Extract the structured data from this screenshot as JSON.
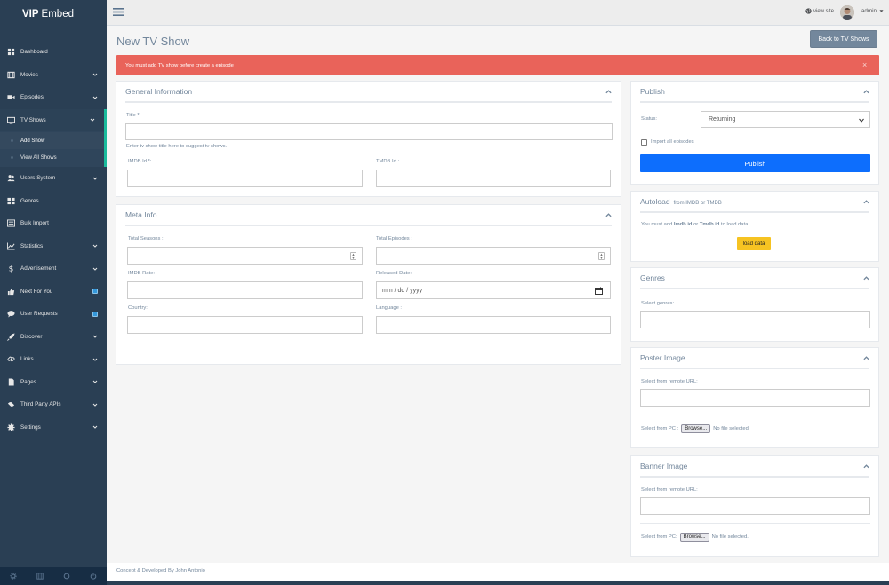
{
  "brand": {
    "name_bold": "VIP",
    "name_rest": "Embed"
  },
  "sidebar": {
    "items": [
      {
        "label": "Dashboard",
        "icon": "dashboard-icon",
        "chevron": false
      },
      {
        "label": "Movies",
        "icon": "film-icon",
        "chevron": true
      },
      {
        "label": "Episodes",
        "icon": "video-camera-icon",
        "chevron": true
      },
      {
        "label": "TV Shows",
        "icon": "tv-icon",
        "chevron": true,
        "active": true
      },
      {
        "label": "Users System",
        "icon": "users-icon",
        "chevron": true
      },
      {
        "label": "Genres",
        "icon": "grid-icon",
        "chevron": false
      },
      {
        "label": "Bulk Import",
        "icon": "list-icon",
        "chevron": false
      },
      {
        "label": "Statistics",
        "icon": "chart-icon",
        "chevron": true
      },
      {
        "label": "Advertisement",
        "icon": "dollar-icon",
        "chevron": true
      },
      {
        "label": "Next For You",
        "icon": "thumbs-up-icon",
        "badge": true
      },
      {
        "label": "User Requests",
        "icon": "comments-icon",
        "badge": true
      },
      {
        "label": "Discover",
        "icon": "rocket-icon",
        "chevron": true
      },
      {
        "label": "Links",
        "icon": "link-icon",
        "chevron": true
      },
      {
        "label": "Pages",
        "icon": "file-icon",
        "chevron": true
      },
      {
        "label": "Third Party APIs",
        "icon": "code-icon",
        "chevron": true
      },
      {
        "label": "Settings",
        "icon": "gear-icon",
        "chevron": true
      }
    ],
    "tv_sub": [
      {
        "label": "Add Show",
        "current": true
      },
      {
        "label": "View All Shows",
        "current": false
      }
    ]
  },
  "topbar": {
    "view_site": "view site",
    "user": "admin"
  },
  "page": {
    "title": "New TV Show",
    "back_button": "Back to TV Shows",
    "alert": "You must add TV show before create a episode"
  },
  "general": {
    "title": "General Information",
    "title_label": "Title *:",
    "title_hint": "Enter tv show title here to suggest tv shows.",
    "imdb_label": "IMDB Id *:",
    "tmdb_label": "TMDB Id :"
  },
  "meta": {
    "title": "Meta Info",
    "seasons_label": "Total Seasons :",
    "episodes_label": "Total Episodes :",
    "rate_label": "IMDB Rate:",
    "date_label": "Released Date:",
    "date_placeholder": "mm / dd / yyyy",
    "country_label": "Country:",
    "language_label": "Language :"
  },
  "publish": {
    "title": "Publish",
    "status_label": "Status:",
    "status_value": "Returning",
    "import_label": "Import all episodes",
    "button": "Publish"
  },
  "autoload": {
    "title": "Autoload",
    "subtitle": "from IMDB or TMDB",
    "msg_1": "You must add ",
    "msg_imdb": "Imdb id",
    "msg_or": " or ",
    "msg_tmdb": "Tmdb id",
    "msg_2": " to load data",
    "button": "load data"
  },
  "genres": {
    "title": "Genres",
    "label": "Select genres:"
  },
  "poster": {
    "title": "Poster Image",
    "remote_label": "Select from remote URL:",
    "pc_label": "Select from PC :",
    "browse": "Browse...",
    "no_file": "No file selected."
  },
  "banner": {
    "title": "Banner Image",
    "remote_label": "Select from remote URL:",
    "pc_label": "Select from PC:",
    "browse": "Browse...",
    "no_file": "No file selected."
  },
  "footer": {
    "text": "Concept & Developed By John Antonio"
  },
  "colors": {
    "sidebar": "#2a3f54",
    "accent": "#1abb9c",
    "alert": "#e9635a",
    "publish": "#0d6efd",
    "load": "#f6c322"
  }
}
